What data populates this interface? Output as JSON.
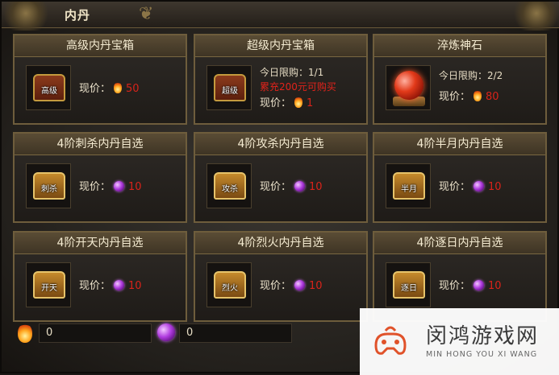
{
  "window": {
    "title": "内丹"
  },
  "items": [
    {
      "name": "高级内丹宝箱",
      "icon": "高级",
      "icon_type": "chest-red",
      "lines": [],
      "price_label": "现价：",
      "currency": "flame-icon",
      "price": "50"
    },
    {
      "name": "超级内丹宝箱",
      "icon": "超级",
      "icon_type": "chest-red",
      "lines": [
        "今日限购：1/1"
      ],
      "note": "累充200元可购买",
      "price_label": "现价：",
      "currency": "flame-icon",
      "price": "1"
    },
    {
      "name": "淬炼神石",
      "icon": "",
      "icon_type": "orb",
      "lines": [
        "今日限购：2/2"
      ],
      "price_label": "现价：",
      "currency": "flame-icon",
      "price": "80"
    },
    {
      "name": "4阶刺杀内丹自选",
      "icon": "刺杀",
      "icon_type": "chest-gold",
      "lines": [],
      "price_label": "现价：",
      "currency": "gem-icon",
      "price": "10"
    },
    {
      "name": "4阶攻杀内丹自选",
      "icon": "攻杀",
      "icon_type": "chest-gold",
      "lines": [],
      "price_label": "现价：",
      "currency": "gem-icon",
      "price": "10"
    },
    {
      "name": "4阶半月内丹自选",
      "icon": "半月",
      "icon_type": "chest-gold",
      "lines": [],
      "price_label": "现价：",
      "currency": "gem-icon",
      "price": "10"
    },
    {
      "name": "4阶开天内丹自选",
      "icon": "开天",
      "icon_type": "chest-gold",
      "lines": [],
      "price_label": "现价：",
      "currency": "gem-icon",
      "price": "10"
    },
    {
      "name": "4阶烈火内丹自选",
      "icon": "烈火",
      "icon_type": "chest-gold",
      "lines": [],
      "price_label": "现价：",
      "currency": "gem-icon",
      "price": "10"
    },
    {
      "name": "4阶逐日内丹自选",
      "icon": "逐日",
      "icon_type": "chest-gold",
      "lines": [],
      "price_label": "现价：",
      "currency": "gem-icon",
      "price": "10"
    }
  ],
  "currency_bar": {
    "flame_amount": "0",
    "gem_amount": "0"
  },
  "watermark": {
    "title": "闵鸿游戏网",
    "subtitle": "MIN HONG YOU XI WANG"
  },
  "colors": {
    "price_red": "#d8231a",
    "card_border": "#6e5d3c",
    "header_text": "#f5ecd2"
  }
}
